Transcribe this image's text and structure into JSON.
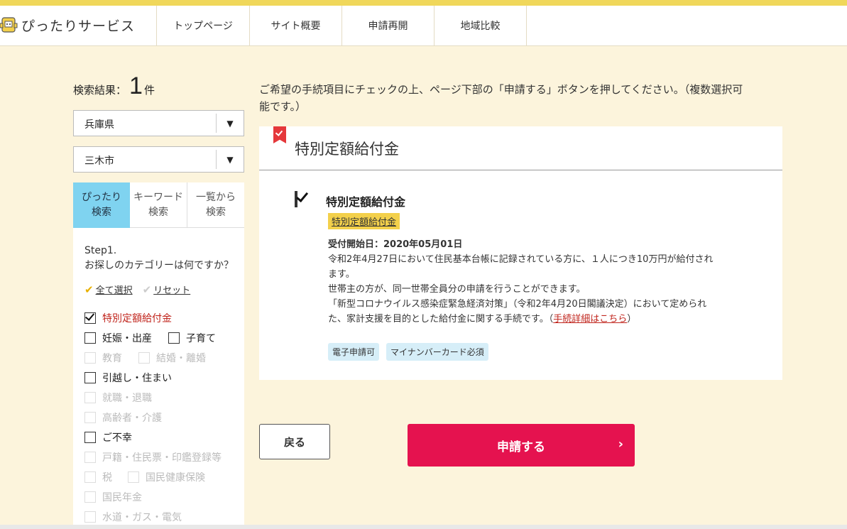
{
  "header": {
    "logo_text": "ぴったりサービス",
    "nav": [
      "トップページ",
      "サイト概要",
      "申請再開",
      "地域比較"
    ]
  },
  "sidebar": {
    "result_label": "検索結果：",
    "result_count": "1",
    "result_unit": "件",
    "prefecture": "兵庫県",
    "city": "三木市",
    "tabs": [
      {
        "line1": "ぴったり",
        "line2": "検索"
      },
      {
        "line1": "キーワード",
        "line2": "検索"
      },
      {
        "line1": "一覧から",
        "line2": "検索"
      }
    ],
    "step_label": "Step1.",
    "step_question": "お探しのカテゴリーは何ですか？",
    "select_all": "全て選択",
    "reset": "リセット",
    "categories": {
      "c0": "特別定額給付金",
      "c1": "妊娠・出産",
      "c2": "子育て",
      "c3": "教育",
      "c4": "結婚・離婚",
      "c5": "引越し・住まい",
      "c6": "就職・退職",
      "c7": "高齢者・介護",
      "c8": "ご不幸",
      "c9": "戸籍・住民票・印鑑登録等",
      "c10": "税",
      "c11": "国民健康保険",
      "c12": "国民年金",
      "c13": "水道・ガス・電気"
    }
  },
  "main": {
    "instruction_line1": "ご希望の手続項目にチェックの上、ページ下部の「申請する」ボタンを押してください。（複数選択可",
    "instruction_line2": "能です。）",
    "card_title": "特別定額給付金",
    "item_title": "特別定額給付金",
    "item_tag": "特別定額給付金",
    "start_date": "受付開始日：2020年05月01日",
    "desc_line1": "令和2年4月27日において住民基本台帳に記録されている方に、１人につき10万円が給付され",
    "desc_line2": "ます。",
    "desc_line3": "世帯主の方が、同一世帯全員分の申請を行うことができます。",
    "desc_line4": "「新型コロナウイルス感染症緊急経済対策」（令和2年4月20日閣議決定）において定められ",
    "desc_line5_pre": "た、家計支援を目的とした給付金に関する手続です。（",
    "desc_line5_link": "手続詳細はこちら",
    "desc_line5_post": "）",
    "badges": [
      "電子申請可",
      "マイナンバーカード必須"
    ],
    "back_label": "戻る",
    "apply_label": "申請する",
    "apply_chevron": "›"
  }
}
